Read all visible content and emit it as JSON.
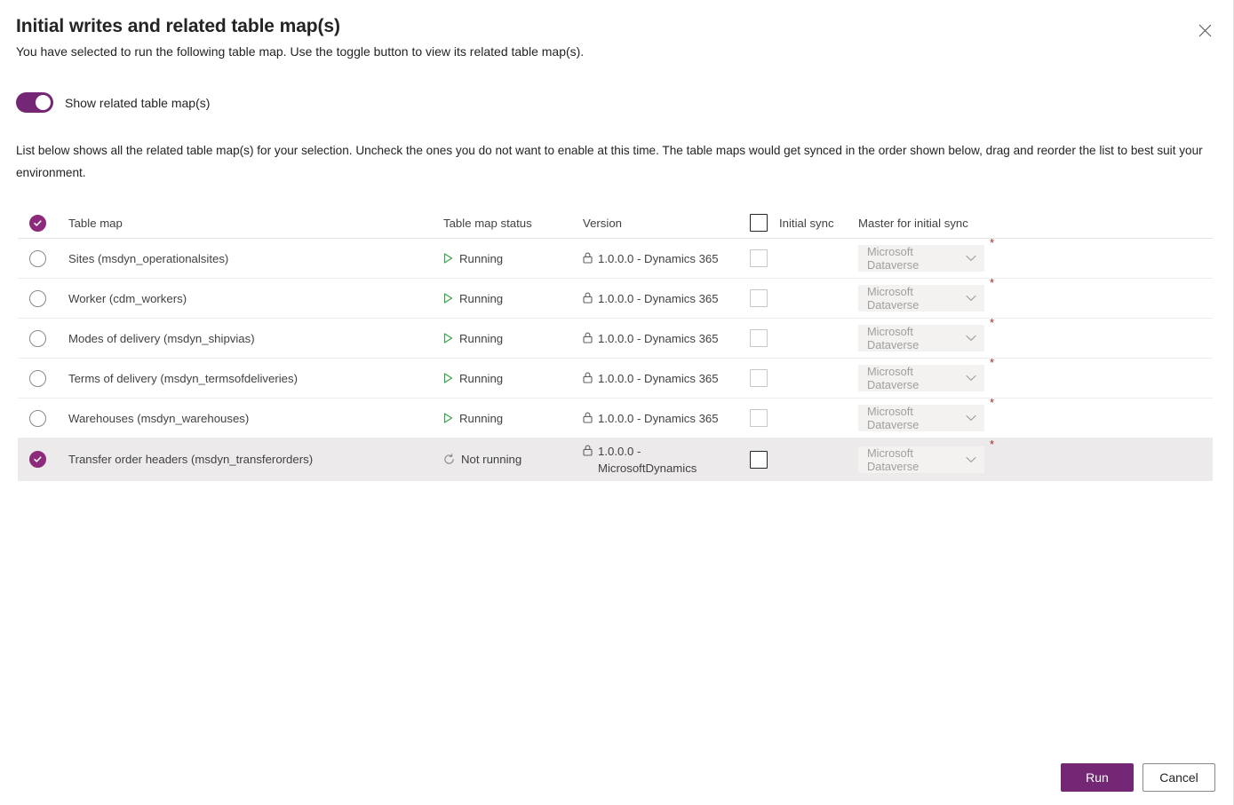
{
  "dialog": {
    "title": "Initial writes and related table map(s)",
    "subtitle": "You have selected to run the following table map. Use the toggle button to view its related table map(s).",
    "close_label": "Close",
    "list_description": "List below shows all the related table map(s) for your selection. Uncheck the ones you do not want to enable at this time. The table maps would get synced in the order shown below, drag and reorder the list to best suit your environment."
  },
  "toggle": {
    "label": "Show related table map(s)",
    "state": "on"
  },
  "table": {
    "headers": {
      "select": "",
      "name": "Table map",
      "status": "Table map status",
      "version": "Version",
      "initial_sync": "Initial sync",
      "master": "Master for initial sync"
    },
    "header_select_checked": true,
    "header_sync_checked": false,
    "rows": [
      {
        "selected": false,
        "name": "Sites (msdyn_operationalsites)",
        "status": "Running",
        "status_icon": "play-icon",
        "version": "1.0.0.0 - Dynamics 365",
        "initial_sync_checked": false,
        "master": "Microsoft Dataverse",
        "master_required": "*",
        "highlighted": false
      },
      {
        "selected": false,
        "name": "Worker (cdm_workers)",
        "status": "Running",
        "status_icon": "play-icon",
        "version": "1.0.0.0 - Dynamics 365",
        "initial_sync_checked": false,
        "master": "Microsoft Dataverse",
        "master_required": "*",
        "highlighted": false
      },
      {
        "selected": false,
        "name": "Modes of delivery (msdyn_shipvias)",
        "status": "Running",
        "status_icon": "play-icon",
        "version": "1.0.0.0 - Dynamics 365",
        "initial_sync_checked": false,
        "master": "Microsoft Dataverse",
        "master_required": "*",
        "highlighted": false
      },
      {
        "selected": false,
        "name": "Terms of delivery (msdyn_termsofdeliveries)",
        "status": "Running",
        "status_icon": "play-icon",
        "version": "1.0.0.0 - Dynamics 365",
        "initial_sync_checked": false,
        "master": "Microsoft Dataverse",
        "master_required": "*",
        "highlighted": false
      },
      {
        "selected": false,
        "name": "Warehouses (msdyn_warehouses)",
        "status": "Running",
        "status_icon": "play-icon",
        "version": "1.0.0.0 - Dynamics 365",
        "initial_sync_checked": false,
        "master": "Microsoft Dataverse",
        "master_required": "*",
        "highlighted": false
      },
      {
        "selected": true,
        "name": "Transfer order headers (msdyn_transferorders)",
        "status": "Not running",
        "status_icon": "not-running-icon",
        "version": "1.0.0.0 - MicrosoftDynamics",
        "initial_sync_checked": false,
        "master": "Microsoft Dataverse",
        "master_required": "*",
        "highlighted": true
      }
    ]
  },
  "footer": {
    "run_label": "Run",
    "cancel_label": "Cancel"
  },
  "colors": {
    "accent": "#742774",
    "selected_circle": "#8d2a7b",
    "running_green": "#3aa34a",
    "required_red": "#a4262c",
    "row_highlight": "#eceaea"
  }
}
